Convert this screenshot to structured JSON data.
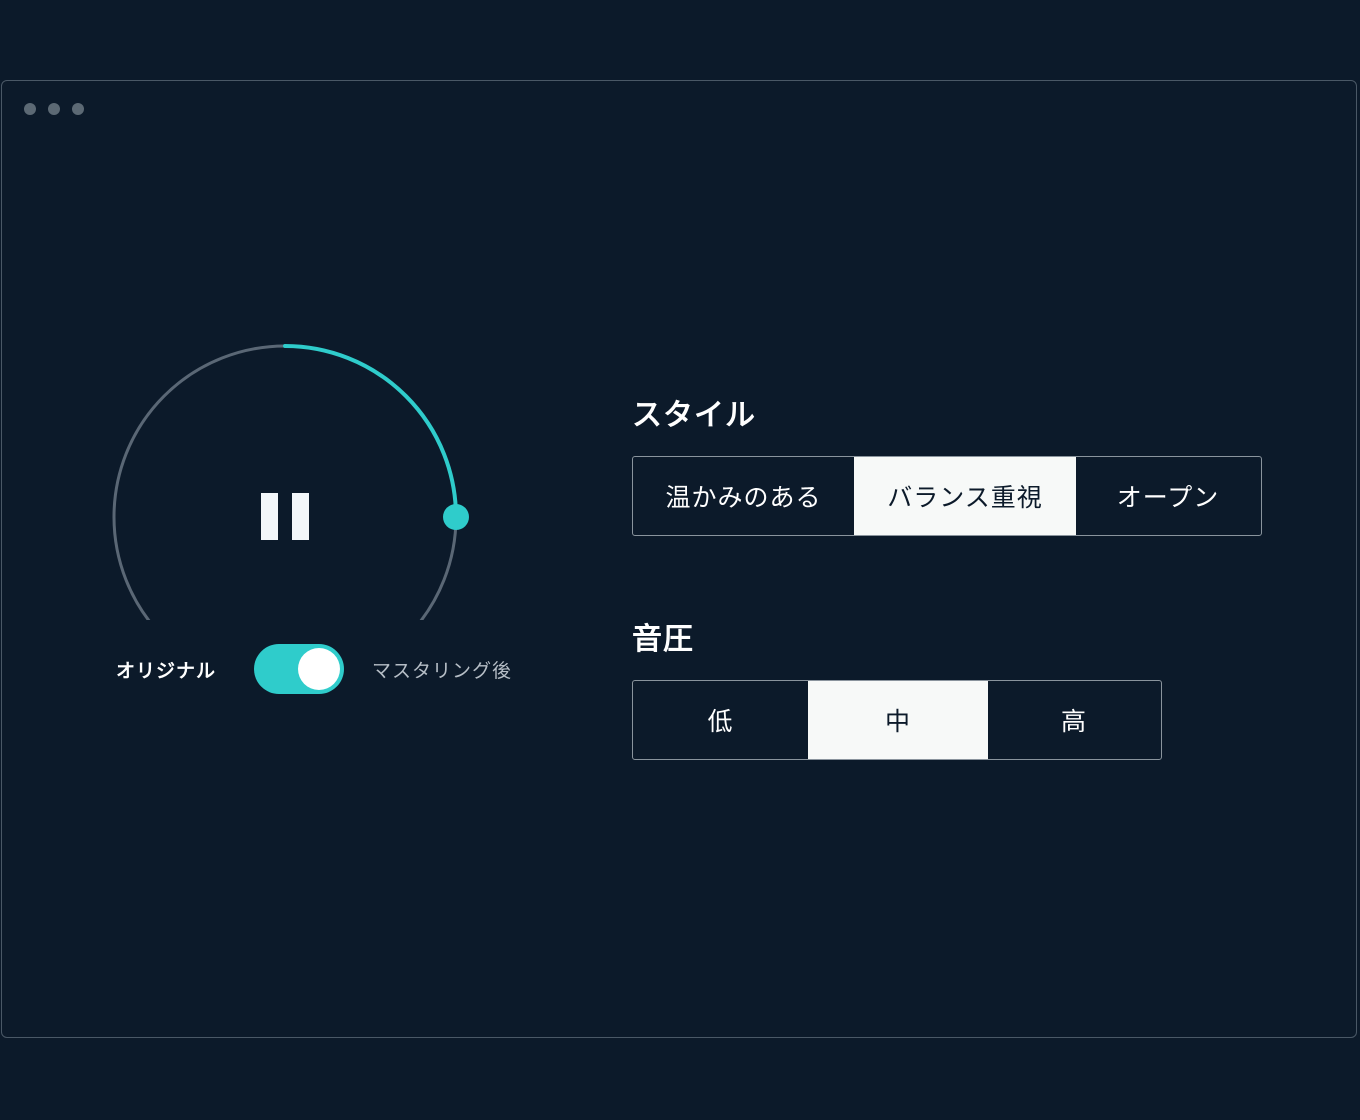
{
  "player": {
    "progress": 0.25,
    "state": "playing",
    "pause_icon": "pause-icon",
    "track_color": "#5a6775",
    "accent_color": "#2fcccb"
  },
  "compare": {
    "left_label": "オリジナル",
    "right_label": "マスタリング後",
    "enabled": true
  },
  "style": {
    "title": "スタイル",
    "options": [
      "温かみのある",
      "バランス重視",
      "オープン"
    ],
    "selected_index": 1
  },
  "loudness": {
    "title": "音圧",
    "options": [
      "低",
      "中",
      "高"
    ],
    "selected_index": 1
  }
}
